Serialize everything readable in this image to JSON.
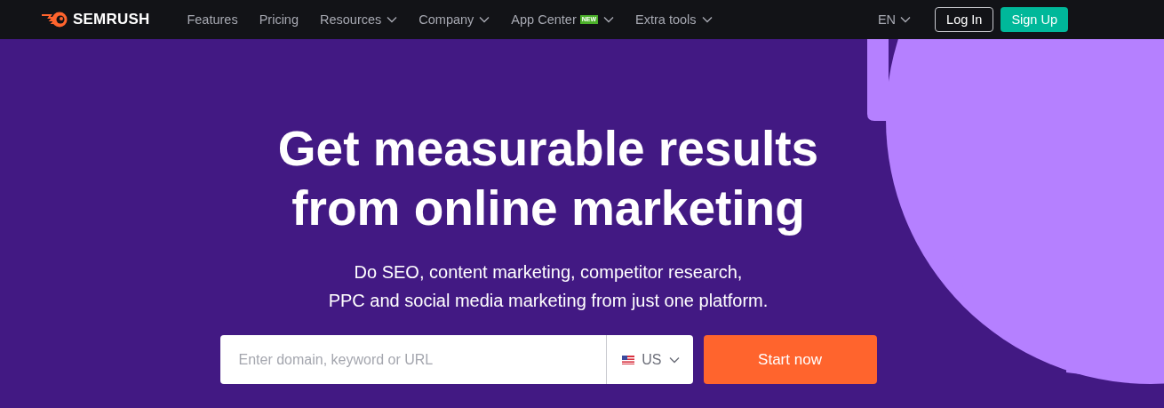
{
  "nav": {
    "logo": "SEMRUSH",
    "links": [
      {
        "label": "Features",
        "dropdown": false
      },
      {
        "label": "Pricing",
        "dropdown": false
      },
      {
        "label": "Resources",
        "dropdown": true
      },
      {
        "label": "Company",
        "dropdown": true
      },
      {
        "label": "App Center",
        "dropdown": true,
        "badge": "NEW"
      },
      {
        "label": "Extra tools",
        "dropdown": true
      }
    ],
    "language": "EN",
    "login": "Log In",
    "signup": "Sign Up"
  },
  "hero": {
    "title_lines": [
      "Get measurable results",
      "from online marketing"
    ],
    "subtitle_lines": [
      "Do SEO, content marketing, competitor research,",
      "PPC and social media marketing from just one platform."
    ],
    "search": {
      "placeholder": "Enter domain, keyword or URL",
      "country": "US",
      "button": "Start now"
    }
  }
}
